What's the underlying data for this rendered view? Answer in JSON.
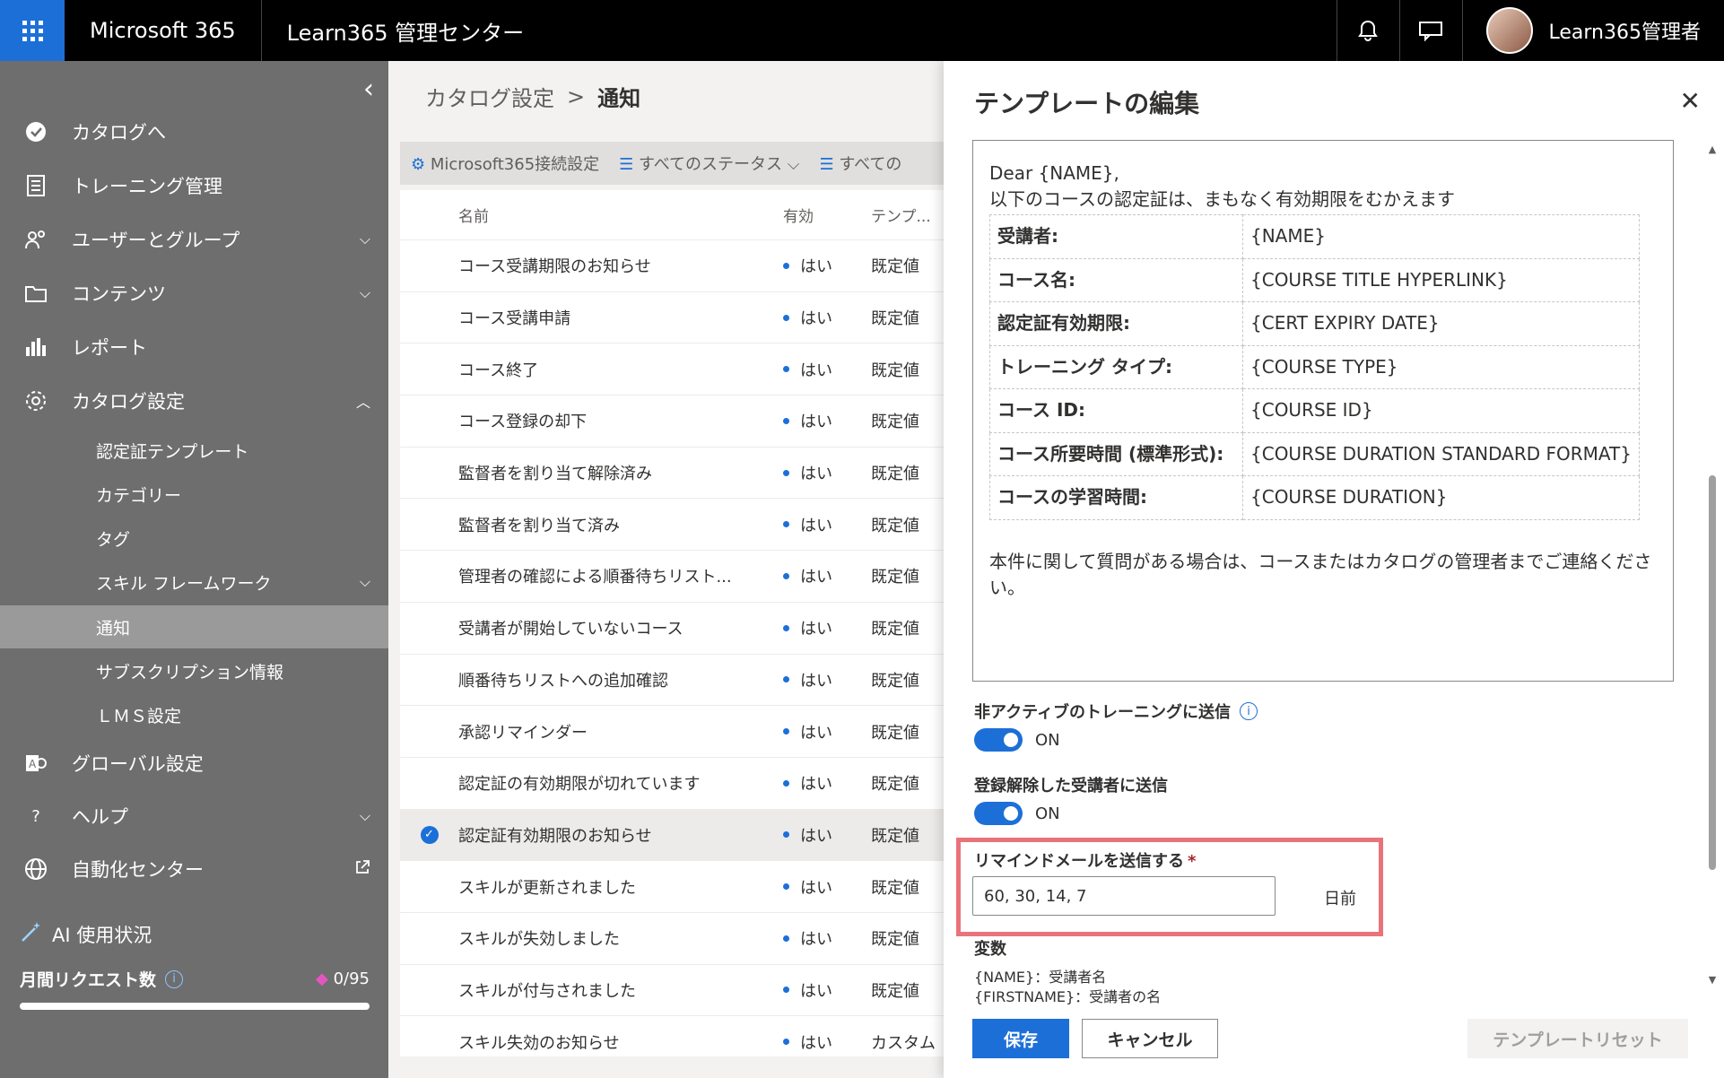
{
  "topbar": {
    "brand": "Microsoft 365",
    "app_title": "Learn365 管理センター",
    "user_name": "Learn365管理者",
    "accent": "#1d6fd8"
  },
  "sidebar": {
    "items": [
      {
        "label": "カタログへ",
        "icon": "check-circle-icon"
      },
      {
        "label": "トレーニング管理",
        "icon": "document-icon"
      },
      {
        "label": "ユーザーとグループ",
        "icon": "people-icon"
      },
      {
        "label": "コンテンツ",
        "icon": "folder-icon"
      },
      {
        "label": "レポート",
        "icon": "bar-chart-icon"
      },
      {
        "label": "カタログ設定",
        "icon": "gear-icon"
      }
    ],
    "sub_items": [
      {
        "label": "認定証テンプレート"
      },
      {
        "label": "カテゴリー"
      },
      {
        "label": "タグ"
      },
      {
        "label": "スキル フレームワーク"
      },
      {
        "label": "通知"
      },
      {
        "label": "サブスクリプション情報"
      },
      {
        "label": "ＬＭＳ設定"
      }
    ],
    "items2": [
      {
        "label": "グローバル設定",
        "icon": "admin-icon"
      },
      {
        "label": "ヘルプ",
        "icon": "question-icon"
      },
      {
        "label": "自動化センター",
        "icon": "globe-icon"
      }
    ],
    "ai_title": "AI 使用状況",
    "monthly_requests_label": "月間リクエスト数",
    "monthly_requests_value": "0/95",
    "monthly_requests_fraction": 0
  },
  "breadcrumb": {
    "parent": "カタログ設定",
    "separator": ">",
    "current": "通知"
  },
  "commandbar": {
    "connect": "Microsoft365接続設定",
    "status_filter": "すべてのステータス",
    "other_filter": "すべての"
  },
  "table": {
    "headers": {
      "name": "名前",
      "valid": "有効",
      "template": "テンプ..."
    },
    "rows": [
      {
        "name": "コース受講期限のお知らせ",
        "valid": "はい",
        "template": "既定値"
      },
      {
        "name": "コース受講申請",
        "valid": "はい",
        "template": "既定値"
      },
      {
        "name": "コース終了",
        "valid": "はい",
        "template": "既定値"
      },
      {
        "name": "コース登録の却下",
        "valid": "はい",
        "template": "既定値"
      },
      {
        "name": "監督者を割り当て解除済み",
        "valid": "はい",
        "template": "既定値"
      },
      {
        "name": "監督者を割り当て済み",
        "valid": "はい",
        "template": "既定値"
      },
      {
        "name": "管理者の確認による順番待ちリスト...",
        "valid": "はい",
        "template": "既定値"
      },
      {
        "name": "受講者が開始していないコース",
        "valid": "はい",
        "template": "既定値"
      },
      {
        "name": "順番待ちリストへの追加確認",
        "valid": "はい",
        "template": "既定値"
      },
      {
        "name": "承認リマインダー",
        "valid": "はい",
        "template": "既定値"
      },
      {
        "name": "認定証の有効期限が切れています",
        "valid": "はい",
        "template": "既定値"
      },
      {
        "name": "認定証有効期限のお知らせ",
        "valid": "はい",
        "template": "既定値"
      },
      {
        "name": "スキルが更新されました",
        "valid": "はい",
        "template": "既定値"
      },
      {
        "name": "スキルが失効しました",
        "valid": "はい",
        "template": "既定値"
      },
      {
        "name": "スキルが付与されました",
        "valid": "はい",
        "template": "既定値"
      },
      {
        "name": "スキル失効のお知らせ",
        "valid": "はい",
        "template": "カスタム"
      }
    ]
  },
  "panel": {
    "title": "テンプレートの編集",
    "greeting": "Dear {NAME},",
    "intro": "以下のコースの認定証は、まもなく有効期限をむかえます",
    "variables_table": [
      {
        "key": "受講者:",
        "value": "{NAME}"
      },
      {
        "key": "コース名:",
        "value": "{COURSE TITLE HYPERLINK}"
      },
      {
        "key": "認定証有効期限:",
        "value": "{CERT EXPIRY DATE}"
      },
      {
        "key": "トレーニング タイプ:",
        "value": "{COURSE TYPE}"
      },
      {
        "key": "コース ID:",
        "value": "{COURSE ID}"
      },
      {
        "key": "コース所要時間 (標準形式):",
        "value": "{COURSE DURATION STANDARD FORMAT}"
      },
      {
        "key": "コースの学習時間:",
        "value": "{COURSE DURATION}"
      }
    ],
    "closing": "本件に関して質問がある場合は、コースまたはカタログの管理者までご連絡ください。",
    "inactive_label": "非アクティブのトレーニングに送信",
    "inactive_state": "ON",
    "unregistered_label": "登録解除した受講者に送信",
    "unregistered_state": "ON",
    "reminder_label": "リマインドメールを送信する",
    "reminder_required": "*",
    "reminder_value": "60, 30, 14, 7",
    "reminder_suffix": "日前",
    "vars_title": "変数",
    "vars_lines": [
      "{NAME}：受講者名",
      "{FIRSTNAME}：受講者の名"
    ],
    "save": "保存",
    "cancel": "キャンセル",
    "reset": "テンプレートリセット"
  }
}
